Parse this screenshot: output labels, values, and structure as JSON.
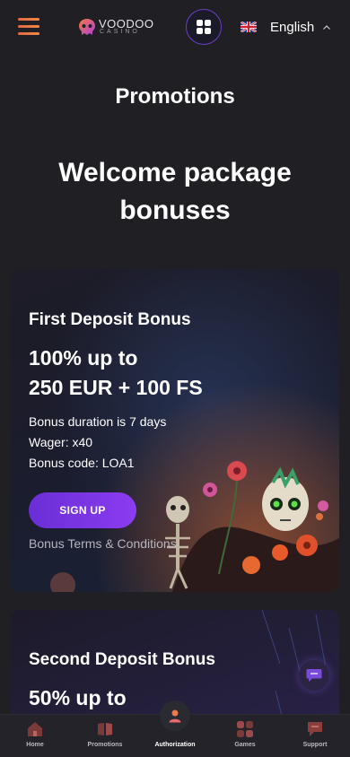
{
  "header": {
    "logo_text": "VOODOO",
    "logo_sub": "CASINO",
    "language": "English"
  },
  "page_title": "Promotions",
  "section_title": "Welcome package bonuses",
  "cards": [
    {
      "title": "First Deposit Bonus",
      "amount_line1": "100% up to",
      "amount_line2": "250 EUR + 100 FS",
      "duration": "Bonus duration is 7 days",
      "wager": "Wager: x40",
      "code": "Bonus code: LOA1",
      "button": "SIGN UP",
      "terms": "Bonus Terms & Conditions"
    },
    {
      "title": "Second Deposit Bonus",
      "amount_line1": "50% up to"
    }
  ],
  "nav": [
    {
      "label": "Home",
      "icon": "home-icon"
    },
    {
      "label": "Promotions",
      "icon": "promotions-icon"
    },
    {
      "label": "Authorization",
      "icon": "user-icon"
    },
    {
      "label": "Games",
      "icon": "games-icon"
    },
    {
      "label": "Support",
      "icon": "support-icon"
    }
  ],
  "colors": {
    "background": "#1f1f24",
    "accent_purple": "#7a34e6",
    "accent_orange": "#e4683f"
  }
}
